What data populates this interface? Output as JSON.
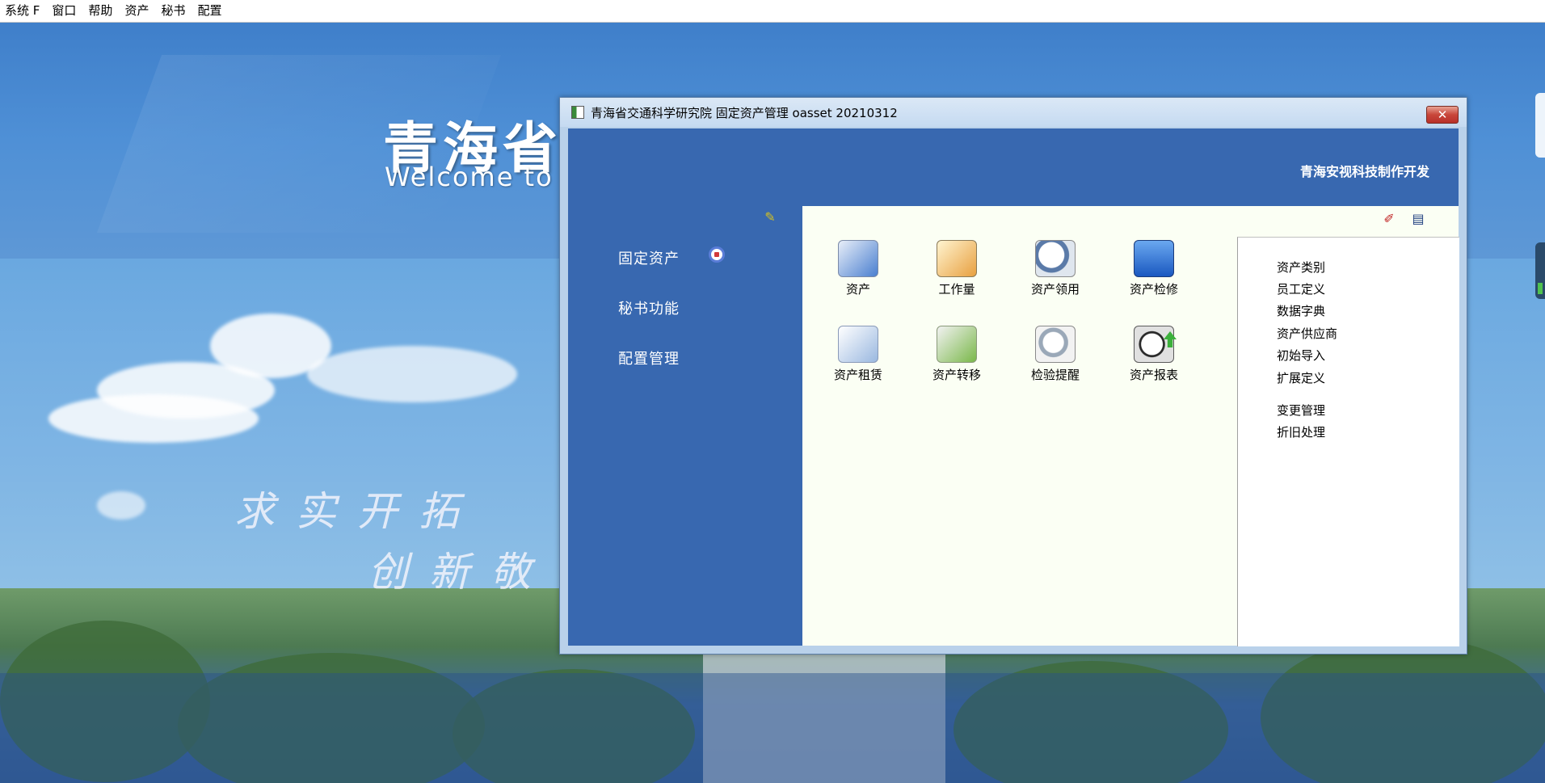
{
  "menubar": {
    "items": [
      "系统 F",
      "窗口",
      "帮助",
      "资产",
      "秘书",
      "配置"
    ]
  },
  "background": {
    "title": "青海省",
    "welcome": "Welcome to C",
    "slogan_line1": "求实开拓",
    "slogan_line2": "创新敬"
  },
  "window": {
    "title": "青海省交通科学研究院 固定资产管理 oasset 20210312",
    "close_label": "✕",
    "header_text": "青海安视科技制作开发"
  },
  "sidebar": {
    "items": [
      "固定资产",
      "秘书功能",
      "配置管理"
    ]
  },
  "modules": {
    "items": [
      "资产",
      "工作量",
      "资产领用",
      "资产检修",
      "资产租赁",
      "资产转移",
      "检验提醒",
      "资产报表"
    ]
  },
  "right_panel": {
    "items": [
      "资产类别",
      "员工定义",
      "数据字典",
      "资产供应商",
      "初始导入",
      "扩展定义",
      "变更管理",
      "折旧处理"
    ]
  },
  "icons": {
    "pin": "pin-icon",
    "tool1": "pen-icon",
    "tool2": "chart-icon"
  }
}
